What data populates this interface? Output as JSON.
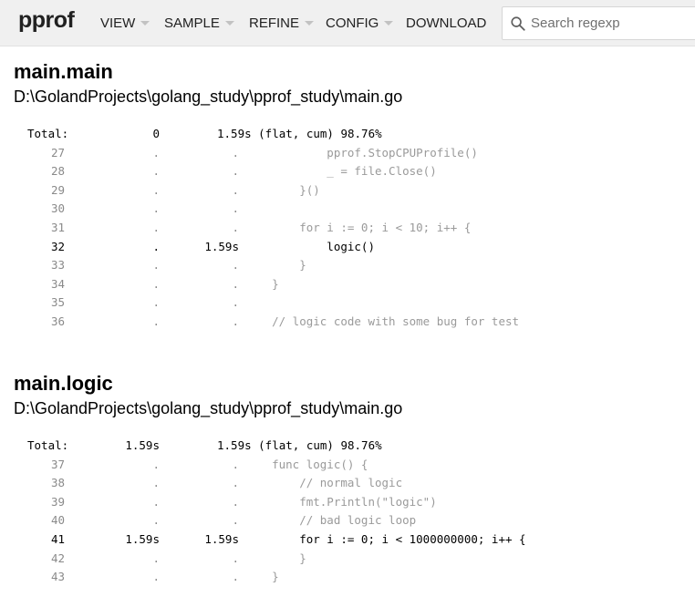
{
  "header": {
    "logo": "pprof",
    "menu": [
      {
        "label": "VIEW",
        "caret": true
      },
      {
        "label": "SAMPLE",
        "caret": true
      },
      {
        "label": "REFINE",
        "caret": true
      },
      {
        "label": "CONFIG",
        "caret": true
      },
      {
        "label": "DOWNLOAD",
        "caret": false
      }
    ],
    "search": {
      "placeholder": "Search regexp",
      "value": ""
    }
  },
  "functions": [
    {
      "name": "main.main",
      "file": "D:\\GolandProjects\\golang_study\\pprof_study\\main.go",
      "total": {
        "label": "Total:",
        "flat": "0",
        "cum": "1.59s (flat, cum) 98.76%"
      },
      "lines": [
        {
          "n": "27",
          "flat": ".",
          "cum": ".",
          "code": "\t\t\tpprof.StopCPUProfile()",
          "hot": false
        },
        {
          "n": "28",
          "flat": ".",
          "cum": ".",
          "code": "\t\t\t_ = file.Close()",
          "hot": false
        },
        {
          "n": "29",
          "flat": ".",
          "cum": ".",
          "code": "\t\t}()",
          "hot": false
        },
        {
          "n": "30",
          "flat": ".",
          "cum": ".",
          "code": "",
          "hot": false
        },
        {
          "n": "31",
          "flat": ".",
          "cum": ".",
          "code": "\t\tfor i := 0; i < 10; i++ {",
          "hot": false
        },
        {
          "n": "32",
          "flat": ".",
          "cum": "1.59s",
          "code": "\t\t\tlogic()",
          "hot": true
        },
        {
          "n": "33",
          "flat": ".",
          "cum": ".",
          "code": "\t\t}",
          "hot": false
        },
        {
          "n": "34",
          "flat": ".",
          "cum": ".",
          "code": "\t}",
          "hot": false
        },
        {
          "n": "35",
          "flat": ".",
          "cum": ".",
          "code": "",
          "hot": false
        },
        {
          "n": "36",
          "flat": ".",
          "cum": ".",
          "code": "\t// logic code with some bug for test",
          "hot": false
        }
      ]
    },
    {
      "name": "main.logic",
      "file": "D:\\GolandProjects\\golang_study\\pprof_study\\main.go",
      "total": {
        "label": "Total:",
        "flat": "1.59s",
        "cum": "1.59s (flat, cum) 98.76%"
      },
      "lines": [
        {
          "n": "37",
          "flat": ".",
          "cum": ".",
          "code": "\tfunc logic() {",
          "hot": false
        },
        {
          "n": "38",
          "flat": ".",
          "cum": ".",
          "code": "\t\t// normal logic",
          "hot": false
        },
        {
          "n": "39",
          "flat": ".",
          "cum": ".",
          "code": "\t\tfmt.Println(\"logic\")",
          "hot": false
        },
        {
          "n": "40",
          "flat": ".",
          "cum": ".",
          "code": "\t\t// bad logic loop",
          "hot": false
        },
        {
          "n": "41",
          "flat": "1.59s",
          "cum": "1.59s",
          "code": "\t\tfor i := 0; i < 1000000000; i++ {",
          "hot": true
        },
        {
          "n": "42",
          "flat": ".",
          "cum": ".",
          "code": "\t\t}",
          "hot": false
        },
        {
          "n": "43",
          "flat": ".",
          "cum": ".",
          "code": "\t}",
          "hot": false
        }
      ]
    }
  ]
}
